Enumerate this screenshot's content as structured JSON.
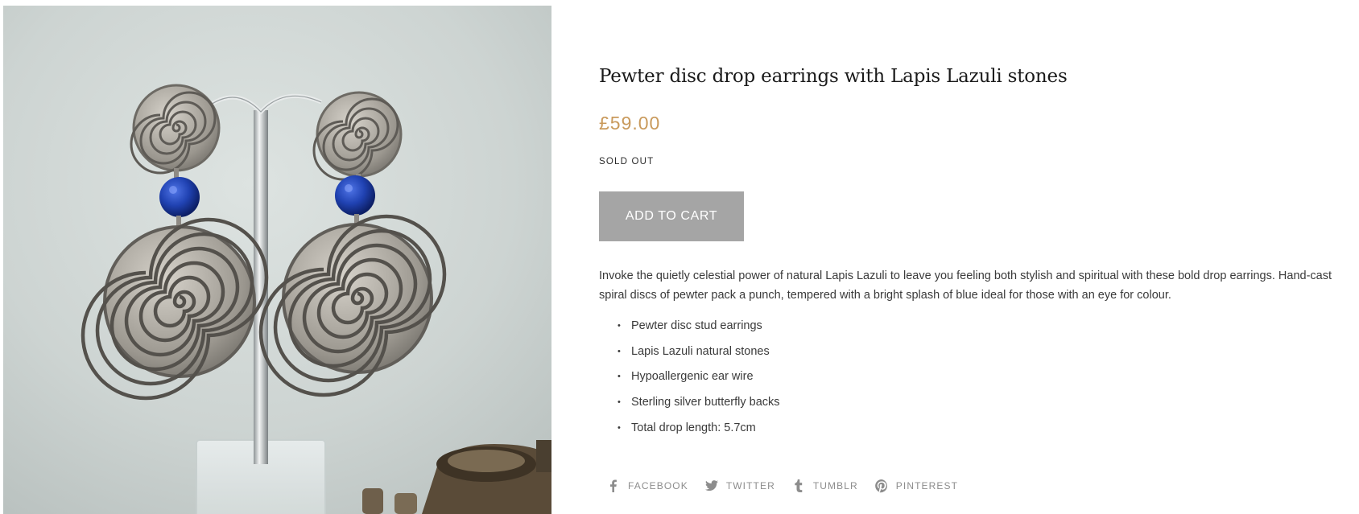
{
  "product": {
    "image_alt": "Pewter disc drop earrings with Lapis Lazuli stones on display stand",
    "title": "Pewter disc drop earrings with Lapis Lazuli stones",
    "price": "£59.00",
    "stock_status": "SOLD OUT",
    "add_to_cart_label": "ADD TO CART",
    "description": "Invoke the quietly celestial power of natural Lapis Lazuli to leave you feeling both stylish and spiritual with these bold drop earrings. Hand-cast spiral discs of pewter pack a punch, tempered with a bright splash of blue ideal for those with an eye for colour.",
    "features": [
      "Pewter disc stud earrings",
      "Lapis Lazuli natural stones",
      "Hypoallergenic ear wire",
      "Sterling silver butterfly backs",
      "Total drop length: 5.7cm"
    ]
  },
  "share": {
    "facebook": {
      "label": "FACEBOOK",
      "icon": "facebook-icon"
    },
    "twitter": {
      "label": "TWITTER",
      "icon": "twitter-icon"
    },
    "tumblr": {
      "label": "TUMBLR",
      "icon": "tumblr-icon"
    },
    "pinterest": {
      "label": "PINTEREST",
      "icon": "pinterest-icon"
    }
  },
  "colors": {
    "price": "#c99a5c",
    "button_bg": "#a5a5a5",
    "button_text": "#ffffff",
    "share_text": "#8d8d8d",
    "body_text": "#3a3a3a",
    "title_text": "#1a1a1a",
    "lapis_blue": "#1f3fa8"
  }
}
